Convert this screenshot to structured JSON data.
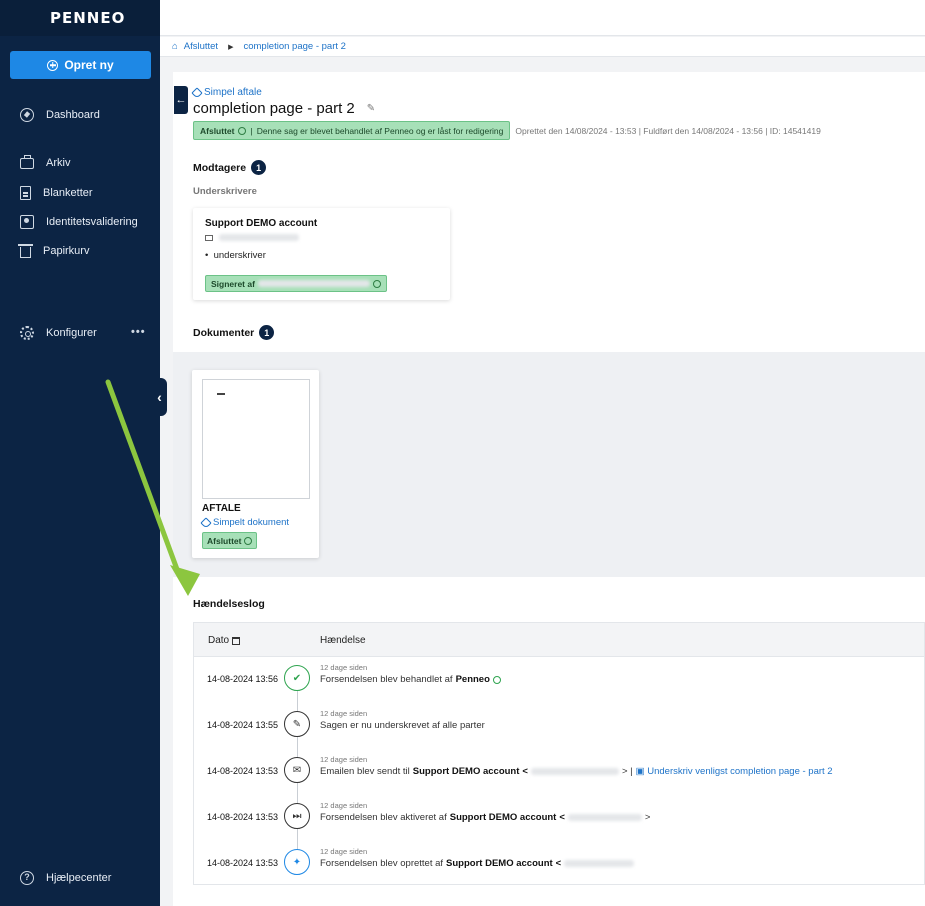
{
  "app": {
    "logo": "PENNEO",
    "create_button": "Opret ny"
  },
  "sidebar": {
    "items": [
      {
        "label": "Dashboard",
        "icon": "compass-icon"
      },
      {
        "label": "Arkiv",
        "icon": "briefcase-icon"
      },
      {
        "label": "Blanketter",
        "icon": "document-icon"
      },
      {
        "label": "Identitetsvalidering",
        "icon": "id-card-icon"
      },
      {
        "label": "Papirkurv",
        "icon": "trash-icon"
      },
      {
        "label": "Konfigurer",
        "icon": "gear-icon"
      },
      {
        "label": "Hjælpecenter",
        "icon": "help-icon"
      }
    ],
    "more": "•••"
  },
  "breadcrumb": {
    "home": "Afsluttet",
    "current": "completion page - part 2"
  },
  "case": {
    "tag": "Simpel aftale",
    "title": "completion page - part 2",
    "status_label": "Afsluttet",
    "status_message": "Denne sag er blevet behandlet af Penneo og er låst for redigering",
    "meta": "Oprettet den 14/08/2024 - 13:53 | Fuldført den 14/08/2024 - 13:56 | ID: 14541419"
  },
  "recipients": {
    "title": "Modtagere",
    "count": "1",
    "group_label": "Underskrivere",
    "items": [
      {
        "name": "Support DEMO account",
        "role": "underskriver",
        "signed_label": "Signeret af"
      }
    ]
  },
  "documents": {
    "title": "Dokumenter",
    "count": "1",
    "items": [
      {
        "name": "AFTALE",
        "type": "Simpelt dokument",
        "status": "Afsluttet"
      }
    ]
  },
  "event_log": {
    "title": "Hændelseslog",
    "columns": {
      "date": "Dato",
      "event": "Hændelse"
    },
    "events": [
      {
        "date": "14-08-2024 13:56",
        "ago": "12 dage siden",
        "text": "Forsendelsen blev behandlet af",
        "strong": "Penneo",
        "suffix": "",
        "link": "",
        "icon": "checkmark-icon"
      },
      {
        "date": "14-08-2024 13:55",
        "ago": "12 dage siden",
        "text": "Sagen er nu underskrevet af alle parter",
        "strong": "",
        "suffix": "",
        "link": "",
        "icon": "pen-icon"
      },
      {
        "date": "14-08-2024 13:53",
        "ago": "12 dage siden",
        "text": "Emailen blev sendt til",
        "strong": "Support DEMO account",
        "suffix": "> |",
        "link": "Underskriv venligst completion page - part 2",
        "icon": "envelope-icon"
      },
      {
        "date": "14-08-2024 13:53",
        "ago": "12 dage siden",
        "text": "Forsendelsen blev aktiveret af",
        "strong": "Support DEMO account",
        "suffix": ">",
        "link": "",
        "icon": "fast-forward-icon"
      },
      {
        "date": "14-08-2024 13:53",
        "ago": "12 dage siden",
        "text": "Forsendelsen blev oprettet af",
        "strong": "Support DEMO account",
        "suffix": "",
        "link": "",
        "icon": "sparkle-icon"
      }
    ]
  },
  "colors": {
    "sidebar": "#0c2444",
    "accent": "#1e88e5",
    "success_bg": "#a7e0b8",
    "arrow": "#8cc63f"
  }
}
